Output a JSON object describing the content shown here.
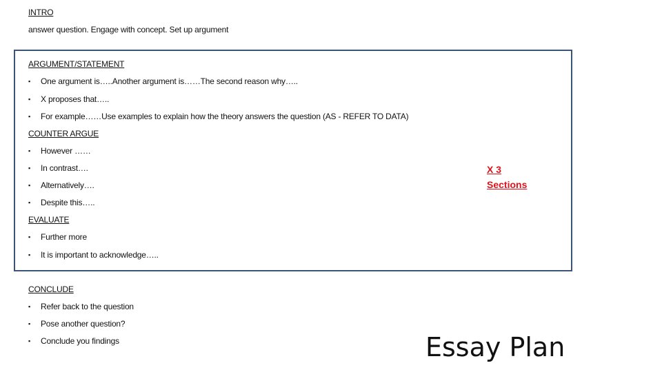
{
  "intro": {
    "heading": "INTRO",
    "text": "answer question. Engage with concept. Set up argument"
  },
  "argument": {
    "heading": "ARGUMENT/STATEMENT",
    "bullets": [
      "One argument is…..Another argument is……The second reason why…..",
      "X proposes that…..",
      "For example……Use examples to explain how the theory answers the question (AS - REFER TO DATA)"
    ]
  },
  "counter": {
    "heading": "COUNTER ARGUE",
    "bullets": [
      "However ……",
      "In contrast….",
      "Alternatively….",
      "Despite this….."
    ]
  },
  "evaluate": {
    "heading": "EVALUATE",
    "bullets": [
      "Further more",
      "It is important to acknowledge….."
    ]
  },
  "conclude": {
    "heading": "CONCLUDE",
    "bullets": [
      "Refer back to the question",
      "Pose another question?",
      "Conclude you findings"
    ]
  },
  "note": {
    "line1": "X 3",
    "line2": "Sections",
    "color": "#e0121b"
  },
  "title": "Essay Plan",
  "bullet_glyph": "▪",
  "border_color": "#3b5476"
}
